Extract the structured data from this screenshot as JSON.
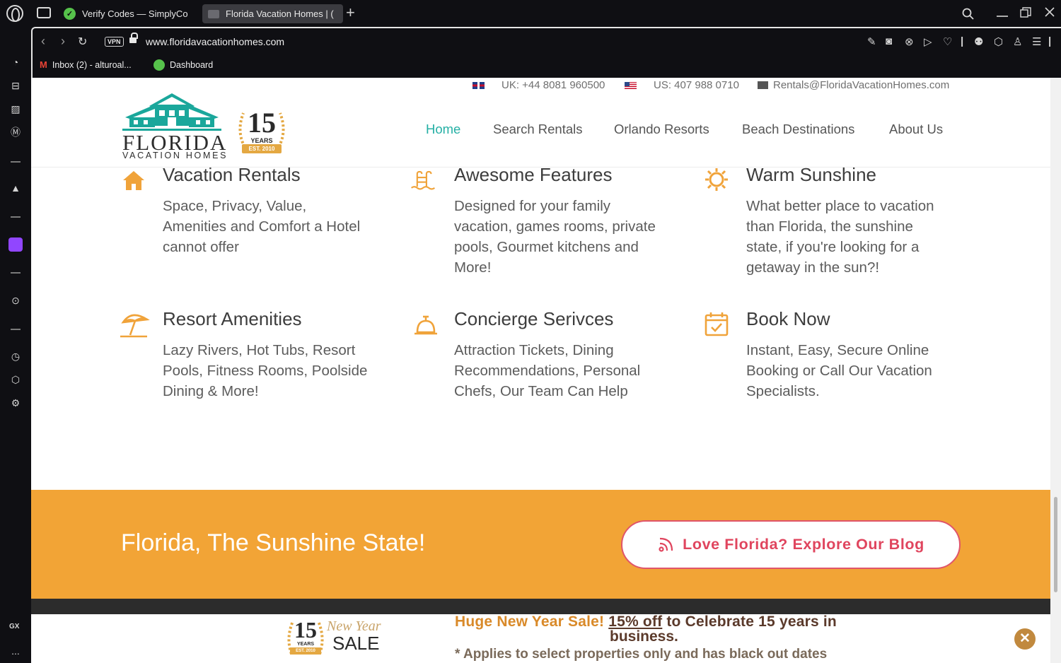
{
  "browser": {
    "tabs": [
      {
        "title": "Verify Codes — SimplyCo",
        "favicon": "simplycodes-icon"
      },
      {
        "title": "Florida Vacation Homes | ( ",
        "favicon": "site-icon"
      }
    ],
    "vpn_label": "VPN",
    "url": "www.floridavacationhomes.com",
    "bookmarks": [
      {
        "label": "Inbox (2) - alturoal...",
        "icon": "gmail-icon"
      },
      {
        "label": "Dashboard",
        "icon": "simplycodes-icon"
      }
    ],
    "sidebar_gx_label": "GX",
    "sidebar_more": "..."
  },
  "topbar": {
    "uk_phone": "UK: +44 8081 960500",
    "us_phone": "US: 407 988 0710",
    "email": "Rentals@FloridaVacationHomes.com"
  },
  "logo": {
    "word": "FLORIDA",
    "sub": "VACATION HOMES",
    "badge_number": "15",
    "badge_years": "YEARS",
    "badge_est": "EST. 2010"
  },
  "nav": {
    "items": [
      "Home",
      "Search Rentals",
      "Orlando Resorts",
      "Beach Destinations",
      "About Us"
    ],
    "active": "Home"
  },
  "features": [
    {
      "icon": "house-icon",
      "title": "Vacation Rentals",
      "text": "Space, Privacy, Value,\nAmenities and Comfort a Hotel\ncannot offer"
    },
    {
      "icon": "pool-icon",
      "title": "Awesome Features",
      "text": "Designed for your family\nvacation, games rooms, private\npools, Gourmet kitchens and\nMore!"
    },
    {
      "icon": "sun-icon",
      "title": "Warm Sunshine",
      "text": "What better place to vacation\nthan Florida, the sunshine\nstate, if you're looking for a\ngetaway in the sun?!"
    },
    {
      "icon": "umbrella-icon",
      "title": "Resort Amenities",
      "text": "Lazy Rivers, Hot Tubs, Resort\nPools, Fitness Rooms, Poolside\nDining & More!"
    },
    {
      "icon": "bell-icon",
      "title": "Concierge Serivces",
      "text": "Attraction Tickets, Dining\nRecommendations, Personal\nChefs, Our Team Can Help"
    },
    {
      "icon": "calendar-icon",
      "title": "Book Now",
      "text": "Instant, Easy, Secure Online\nBooking or Call Our Vacation\nSpecialists."
    }
  ],
  "banner": {
    "title": "Florida, The Sunshine State!",
    "button": "Love Florida? Explore Our Blog"
  },
  "promo": {
    "logo_number": "15",
    "logo_years": "YEARS",
    "logo_est": "EST. 2010",
    "logo_script": "New Year",
    "logo_sale": "SALE",
    "highlight": "Huge New Year Sale!",
    "discount": "15% off",
    "line1_rest": " to Celebrate 15 years in",
    "line2": "business.",
    "line3": "* Applies to select properties only and has black out dates",
    "close": "✕"
  },
  "colors": {
    "teal": "#25b0a5",
    "orange": "#f2a436",
    "coral": "#e0455e",
    "icon_orange": "#f0a33a"
  }
}
